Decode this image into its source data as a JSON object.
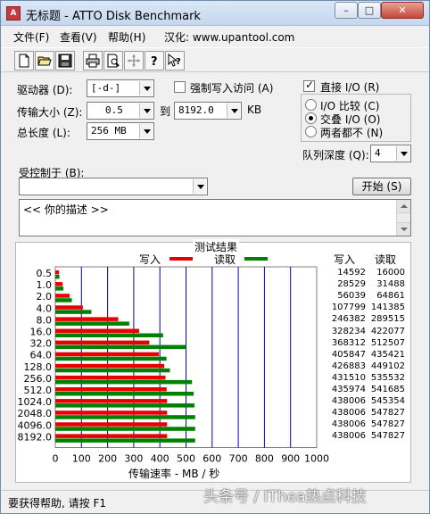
{
  "window": {
    "title": "无标题 - ATTO Disk Benchmark",
    "icon_label": "A",
    "controls": {
      "minimize": "–",
      "maximize": "□",
      "close": "✕"
    }
  },
  "menu": {
    "items": [
      "文件(F)",
      "查看(V)",
      "帮助(H)"
    ],
    "localized_by": "汉化: www.upantool.com"
  },
  "toolbar": {
    "icons": [
      "new-document-icon",
      "open-folder-icon",
      "save-disk-icon",
      "print-icon",
      "print-preview-icon",
      "move-cross-icon",
      "help-question-icon",
      "context-help-icon"
    ]
  },
  "settings": {
    "drive_label": "驱动器 (D):",
    "drive_value": "[-d-]",
    "force_write_label": "强制写入访问 (A)",
    "force_write_checked": false,
    "transfer_size_label": "传输大小 (Z):",
    "transfer_from": "0.5",
    "to_label": "到",
    "transfer_to": "8192.0",
    "kb_label": "KB",
    "total_length_label": "总长度 (L):",
    "total_length_value": "256 MB",
    "direct_io_label": "直接 I/O (R)",
    "direct_io_checked": true,
    "io_options": [
      {
        "label": "I/O 比较 (C)",
        "selected": false
      },
      {
        "label": "交叠 I/O (O)",
        "selected": true
      },
      {
        "label": "两者都不 (N)",
        "selected": false
      }
    ],
    "queue_depth_label": "队列深度 (Q):",
    "queue_depth_value": "4",
    "controlled_by_label": "受控制于 (B):",
    "controlled_by_value": "",
    "start_button": "开始 (S)",
    "description_text": "<<   你的描述    >>"
  },
  "results": {
    "group_title": "测试结果",
    "legend_write": "写入",
    "legend_read": "读取",
    "col_write": "写入",
    "col_read": "读取",
    "write_color": "#e60000",
    "read_color": "#008000"
  },
  "chart_data": {
    "type": "bar",
    "orientation": "horizontal",
    "categories": [
      "0.5",
      "1.0",
      "2.0",
      "4.0",
      "8.0",
      "16.0",
      "32.0",
      "64.0",
      "128.0",
      "256.0",
      "512.0",
      "1024.0",
      "2048.0",
      "4096.0",
      "8192.0"
    ],
    "series": [
      {
        "name": "写入",
        "values": [
          14592,
          28529,
          56039,
          107799,
          246382,
          328234,
          368312,
          405847,
          426883,
          431510,
          435974,
          438006,
          438006,
          438006,
          438006
        ]
      },
      {
        "name": "读取",
        "values": [
          16000,
          31488,
          64861,
          141385,
          289515,
          422077,
          512507,
          435421,
          449102,
          535532,
          541685,
          545354,
          547827,
          547827,
          547827
        ]
      }
    ],
    "xlabel": "传输速率 - MB / 秒",
    "xticks": [
      "0",
      "100",
      "200",
      "300",
      "400",
      "500",
      "600",
      "700",
      "800",
      "900",
      "1000"
    ],
    "xlim": [
      0,
      1000
    ],
    "grid": true
  },
  "status": {
    "text": "要获得帮助, 请按 F1"
  },
  "watermark": "头条号 / IThea热点科技"
}
